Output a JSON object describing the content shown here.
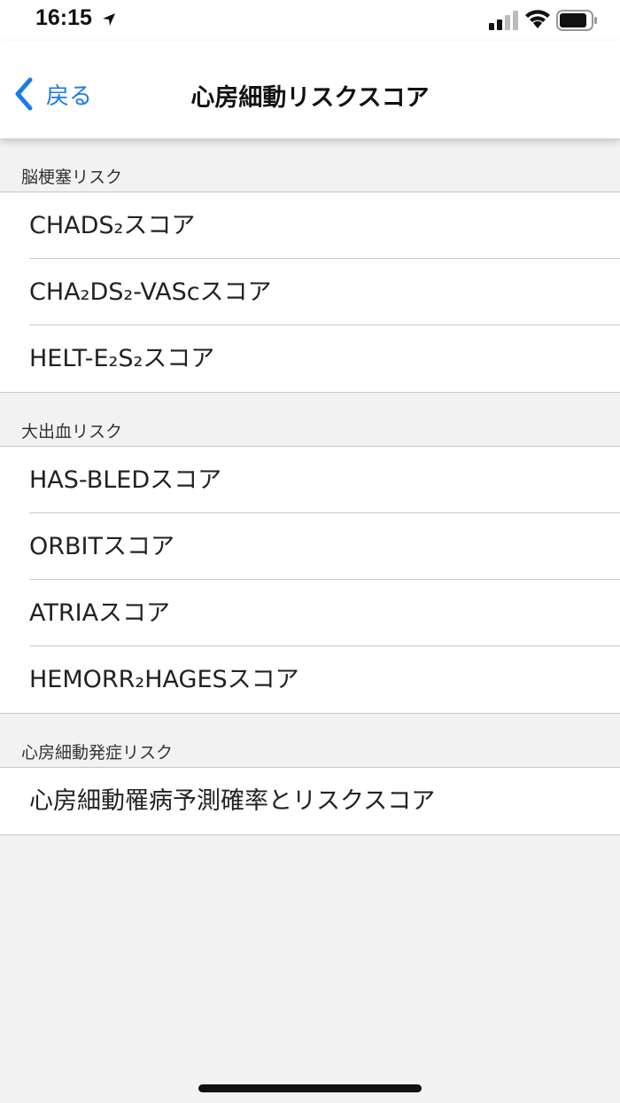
{
  "status_bar": {
    "time": "16:15"
  },
  "nav": {
    "back_label": "戻る",
    "title": "心房細動リスクスコア"
  },
  "sections": [
    {
      "header": "脳梗塞リスク",
      "items": [
        "CHADS₂スコア",
        "CHA₂DS₂-VAScスコア",
        "HELT-E₂S₂スコア"
      ]
    },
    {
      "header": "大出血リスク",
      "items": [
        "HAS-BLEDスコア",
        "ORBITスコア",
        "ATRIAスコア",
        "HEMORR₂HAGESスコア"
      ]
    },
    {
      "header": "心房細動発症リスク",
      "items": [
        "心房細動罹病予測確率とリスクスコア"
      ]
    }
  ],
  "colors": {
    "accent": "#1a7ae8",
    "background": "#f2f2f2",
    "separator": "#c8c8c8"
  }
}
